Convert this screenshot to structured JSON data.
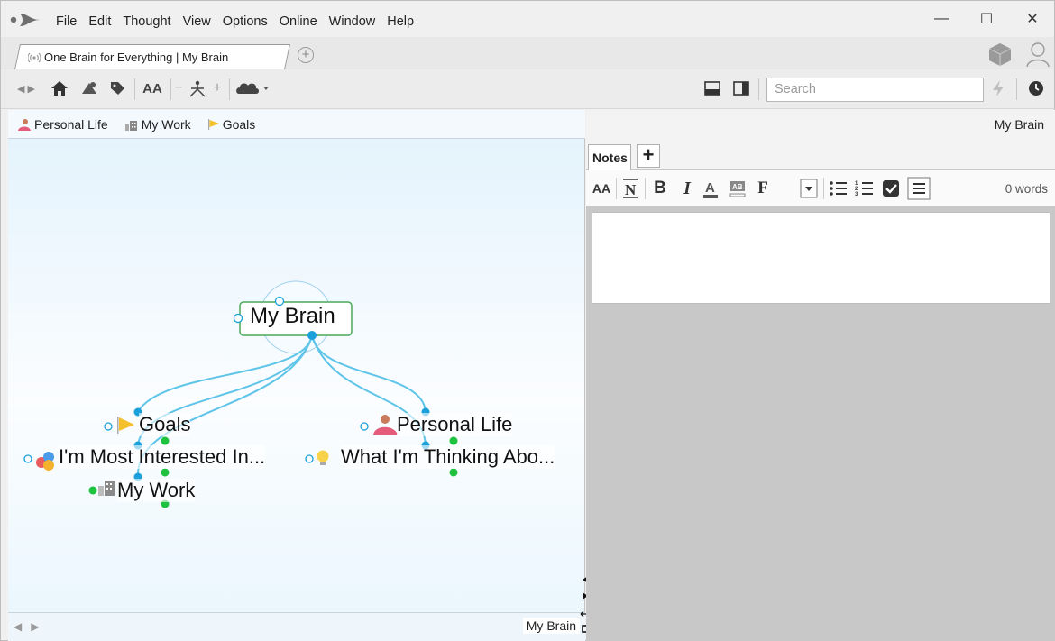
{
  "menu": {
    "items": [
      "File",
      "Edit",
      "Thought",
      "View",
      "Options",
      "Online",
      "Window",
      "Help"
    ]
  },
  "window_controls": {
    "minimize": "—",
    "maximize": "☐",
    "close": "✕"
  },
  "tab": {
    "label": "One Brain for Everything | My Brain",
    "new_tab": "+"
  },
  "toolbar": {
    "search_placeholder": "Search",
    "font_label": "AA",
    "minus": "−",
    "plus": "+"
  },
  "pins": [
    {
      "label": "Personal Life",
      "icon": "person-icon"
    },
    {
      "label": "My Work",
      "icon": "office-icon"
    },
    {
      "label": "Goals",
      "icon": "flag-icon"
    }
  ],
  "plex": {
    "active": "My Brain",
    "children": [
      {
        "label": "Goals",
        "icon": "flag-icon"
      },
      {
        "label": "I'm Most Interested In...",
        "icon": "circles-icon"
      },
      {
        "label": "My Work",
        "icon": "office-icon"
      },
      {
        "label": "Personal Life",
        "icon": "person-icon"
      },
      {
        "label": "What I'm Thinking Abo...",
        "icon": "lightbulb-icon"
      }
    ]
  },
  "bottom": {
    "title": "My Brain"
  },
  "right": {
    "title": "My Brain",
    "notes_tab": "Notes",
    "add_tab": "+",
    "word_count": "0 words",
    "format": {
      "font": "AA",
      "bold": "B",
      "italic": "I",
      "font_face": "F"
    }
  },
  "colors": {
    "link": "#5ec4e8",
    "active_border": "#4aa85a",
    "gate_green": "#1ec23e",
    "gate_blue": "#1ba0dc"
  }
}
